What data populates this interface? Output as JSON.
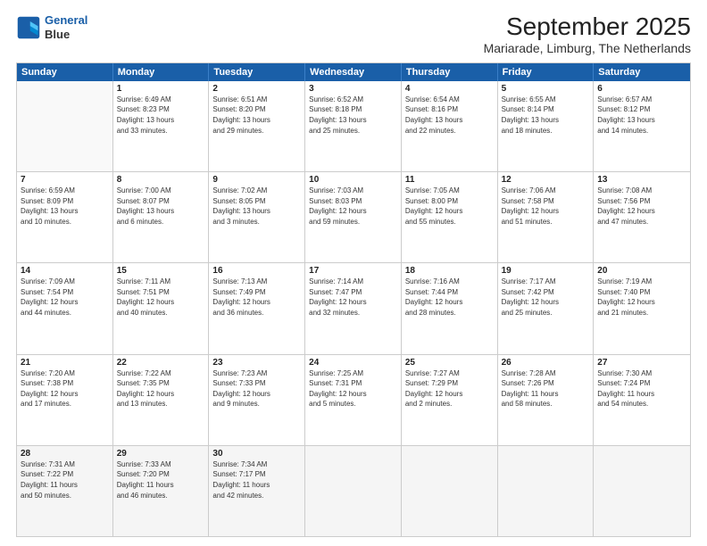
{
  "logo": {
    "line1": "General",
    "line2": "Blue"
  },
  "title": "September 2025",
  "subtitle": "Mariarade, Limburg, The Netherlands",
  "header_days": [
    "Sunday",
    "Monday",
    "Tuesday",
    "Wednesday",
    "Thursday",
    "Friday",
    "Saturday"
  ],
  "weeks": [
    [
      {
        "day": "",
        "info": ""
      },
      {
        "day": "1",
        "info": "Sunrise: 6:49 AM\nSunset: 8:23 PM\nDaylight: 13 hours\nand 33 minutes."
      },
      {
        "day": "2",
        "info": "Sunrise: 6:51 AM\nSunset: 8:20 PM\nDaylight: 13 hours\nand 29 minutes."
      },
      {
        "day": "3",
        "info": "Sunrise: 6:52 AM\nSunset: 8:18 PM\nDaylight: 13 hours\nand 25 minutes."
      },
      {
        "day": "4",
        "info": "Sunrise: 6:54 AM\nSunset: 8:16 PM\nDaylight: 13 hours\nand 22 minutes."
      },
      {
        "day": "5",
        "info": "Sunrise: 6:55 AM\nSunset: 8:14 PM\nDaylight: 13 hours\nand 18 minutes."
      },
      {
        "day": "6",
        "info": "Sunrise: 6:57 AM\nSunset: 8:12 PM\nDaylight: 13 hours\nand 14 minutes."
      }
    ],
    [
      {
        "day": "7",
        "info": "Sunrise: 6:59 AM\nSunset: 8:09 PM\nDaylight: 13 hours\nand 10 minutes."
      },
      {
        "day": "8",
        "info": "Sunrise: 7:00 AM\nSunset: 8:07 PM\nDaylight: 13 hours\nand 6 minutes."
      },
      {
        "day": "9",
        "info": "Sunrise: 7:02 AM\nSunset: 8:05 PM\nDaylight: 13 hours\nand 3 minutes."
      },
      {
        "day": "10",
        "info": "Sunrise: 7:03 AM\nSunset: 8:03 PM\nDaylight: 12 hours\nand 59 minutes."
      },
      {
        "day": "11",
        "info": "Sunrise: 7:05 AM\nSunset: 8:00 PM\nDaylight: 12 hours\nand 55 minutes."
      },
      {
        "day": "12",
        "info": "Sunrise: 7:06 AM\nSunset: 7:58 PM\nDaylight: 12 hours\nand 51 minutes."
      },
      {
        "day": "13",
        "info": "Sunrise: 7:08 AM\nSunset: 7:56 PM\nDaylight: 12 hours\nand 47 minutes."
      }
    ],
    [
      {
        "day": "14",
        "info": "Sunrise: 7:09 AM\nSunset: 7:54 PM\nDaylight: 12 hours\nand 44 minutes."
      },
      {
        "day": "15",
        "info": "Sunrise: 7:11 AM\nSunset: 7:51 PM\nDaylight: 12 hours\nand 40 minutes."
      },
      {
        "day": "16",
        "info": "Sunrise: 7:13 AM\nSunset: 7:49 PM\nDaylight: 12 hours\nand 36 minutes."
      },
      {
        "day": "17",
        "info": "Sunrise: 7:14 AM\nSunset: 7:47 PM\nDaylight: 12 hours\nand 32 minutes."
      },
      {
        "day": "18",
        "info": "Sunrise: 7:16 AM\nSunset: 7:44 PM\nDaylight: 12 hours\nand 28 minutes."
      },
      {
        "day": "19",
        "info": "Sunrise: 7:17 AM\nSunset: 7:42 PM\nDaylight: 12 hours\nand 25 minutes."
      },
      {
        "day": "20",
        "info": "Sunrise: 7:19 AM\nSunset: 7:40 PM\nDaylight: 12 hours\nand 21 minutes."
      }
    ],
    [
      {
        "day": "21",
        "info": "Sunrise: 7:20 AM\nSunset: 7:38 PM\nDaylight: 12 hours\nand 17 minutes."
      },
      {
        "day": "22",
        "info": "Sunrise: 7:22 AM\nSunset: 7:35 PM\nDaylight: 12 hours\nand 13 minutes."
      },
      {
        "day": "23",
        "info": "Sunrise: 7:23 AM\nSunset: 7:33 PM\nDaylight: 12 hours\nand 9 minutes."
      },
      {
        "day": "24",
        "info": "Sunrise: 7:25 AM\nSunset: 7:31 PM\nDaylight: 12 hours\nand 5 minutes."
      },
      {
        "day": "25",
        "info": "Sunrise: 7:27 AM\nSunset: 7:29 PM\nDaylight: 12 hours\nand 2 minutes."
      },
      {
        "day": "26",
        "info": "Sunrise: 7:28 AM\nSunset: 7:26 PM\nDaylight: 11 hours\nand 58 minutes."
      },
      {
        "day": "27",
        "info": "Sunrise: 7:30 AM\nSunset: 7:24 PM\nDaylight: 11 hours\nand 54 minutes."
      }
    ],
    [
      {
        "day": "28",
        "info": "Sunrise: 7:31 AM\nSunset: 7:22 PM\nDaylight: 11 hours\nand 50 minutes."
      },
      {
        "day": "29",
        "info": "Sunrise: 7:33 AM\nSunset: 7:20 PM\nDaylight: 11 hours\nand 46 minutes."
      },
      {
        "day": "30",
        "info": "Sunrise: 7:34 AM\nSunset: 7:17 PM\nDaylight: 11 hours\nand 42 minutes."
      },
      {
        "day": "",
        "info": ""
      },
      {
        "day": "",
        "info": ""
      },
      {
        "day": "",
        "info": ""
      },
      {
        "day": "",
        "info": ""
      }
    ]
  ]
}
